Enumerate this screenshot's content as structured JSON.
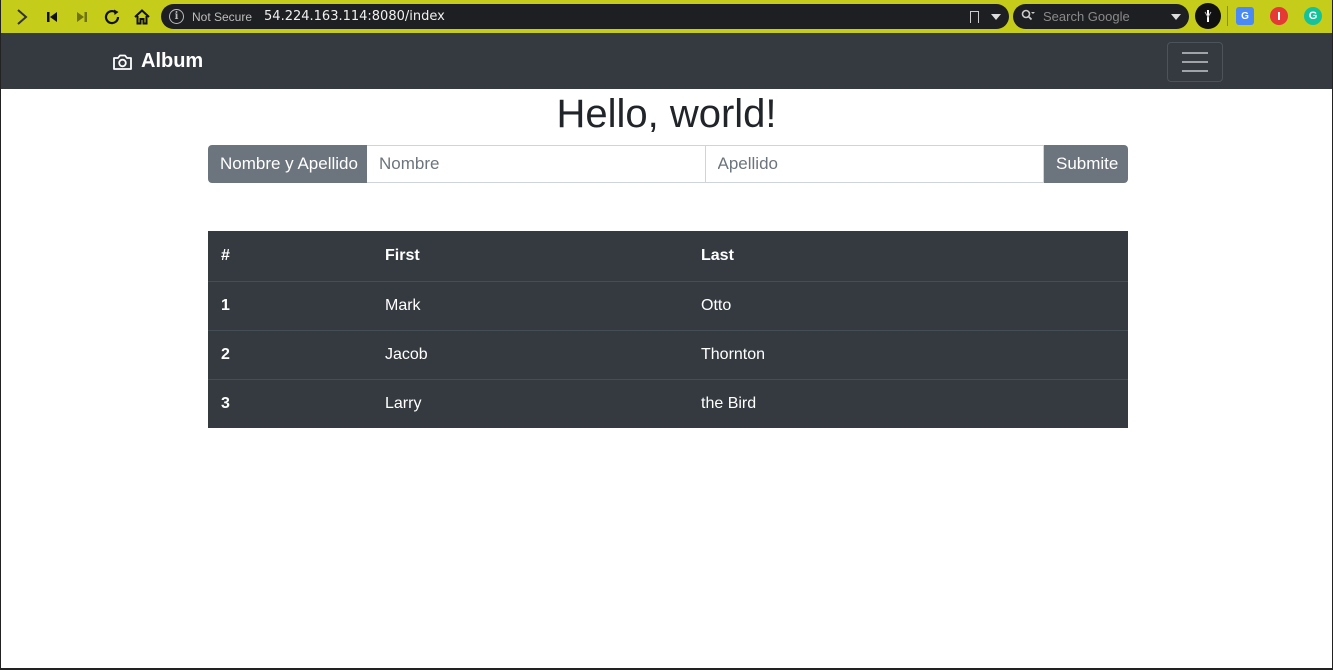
{
  "browser": {
    "security_label": "Not Secure",
    "url": "54.224.163.114:8080/index",
    "search_placeholder": "Search Google"
  },
  "navbar": {
    "brand": "Album"
  },
  "main": {
    "title": "Hello, world!",
    "form": {
      "label": "Nombre y Apellido",
      "first_placeholder": "Nombre",
      "last_placeholder": "Apellido",
      "submit_label": "Submite"
    },
    "table": {
      "headers": [
        "#",
        "First",
        "Last"
      ],
      "rows": [
        {
          "num": "1",
          "first": "Mark",
          "last": "Otto"
        },
        {
          "num": "2",
          "first": "Jacob",
          "last": "Thornton"
        },
        {
          "num": "3",
          "first": "Larry",
          "last": "the Bird"
        }
      ]
    }
  },
  "colors": {
    "browser_bar": "#c5cc1a",
    "navbar": "#343a40",
    "table_bg": "#343a40",
    "secondary": "#6c757d"
  }
}
